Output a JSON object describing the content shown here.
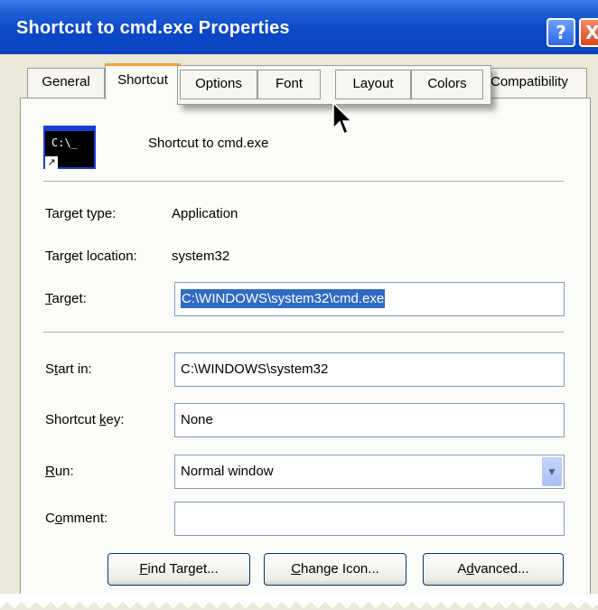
{
  "window": {
    "title": "Shortcut to cmd.exe Properties",
    "help_label": "?",
    "close_label": "X"
  },
  "tabs": {
    "general": "General",
    "shortcut": "Shortcut",
    "options": "Options",
    "font": "Font",
    "layout": "Layout",
    "colors": "Colors",
    "compatibility": "Compatibility"
  },
  "header": {
    "icon_text": "C:\\_",
    "name": "Shortcut to cmd.exe"
  },
  "info": {
    "target_type_label": "Target type:",
    "target_type_value": "Application",
    "target_location_label": "Target location:",
    "target_location_value": "system32"
  },
  "fields": {
    "target_label_u": "T",
    "target_label_rest": "arget:",
    "target_value": "C:\\WINDOWS\\system32\\cmd.exe",
    "start_in_label_a": "S",
    "start_in_label_u": "t",
    "start_in_label_b": "art in:",
    "start_in_value": "C:\\WINDOWS\\system32",
    "shortcut_key_label_a": "Shortcut ",
    "shortcut_key_label_u": "k",
    "shortcut_key_label_b": "ey:",
    "shortcut_key_value": "None",
    "run_label_u": "R",
    "run_label_rest": "un:",
    "run_value": "Normal window",
    "comment_label_a": "C",
    "comment_label_u": "o",
    "comment_label_b": "mment:",
    "comment_value": ""
  },
  "buttons": {
    "find_target_u": "F",
    "find_target_rest": "ind Target...",
    "change_icon_u": "C",
    "change_icon_rest": "hange Icon...",
    "advanced_a": "A",
    "advanced_u": "d",
    "advanced_b": "vanced..."
  },
  "colors": {
    "titlebar": "#0b45be",
    "dialog_bg": "#ece9d8",
    "selection": "#316ac5",
    "active_tab_accent": "#f3a33c"
  }
}
